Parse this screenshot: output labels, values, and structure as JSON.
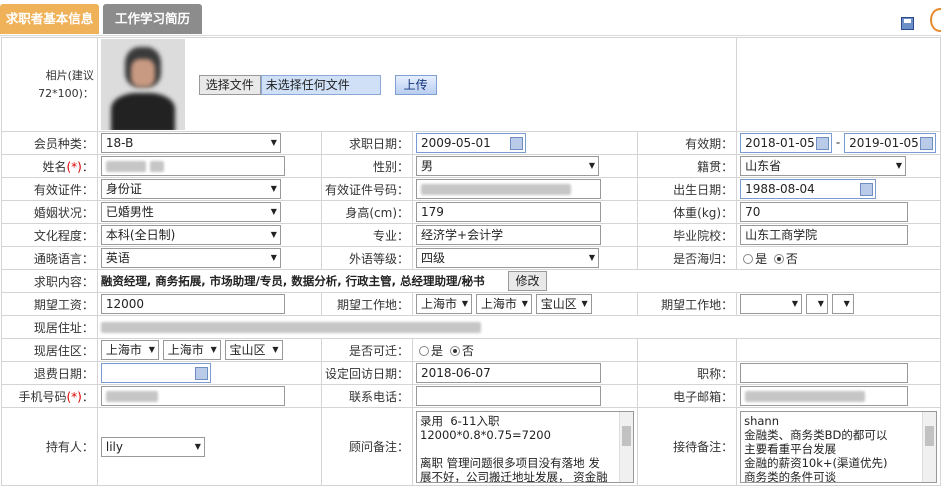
{
  "tabs": {
    "basic": "求职者基本信息",
    "resume": "工作学习简历"
  },
  "photo": {
    "label": "相片(建议72*100)：",
    "choose_file": "选择文件",
    "no_file": "未选择任何文件",
    "upload": "上传"
  },
  "member_type": {
    "label": "会员种类：",
    "value": "18-B"
  },
  "apply_date": {
    "label": "求职日期：",
    "value": "2009-05-01"
  },
  "valid_period": {
    "label": "有效期：",
    "from": "2018-01-05",
    "sep": "-",
    "to": "2019-01-05"
  },
  "name": {
    "label": "姓名",
    "star": "(*)",
    "colon": "："
  },
  "gender": {
    "label": "性别：",
    "value": "男"
  },
  "native": {
    "label": "籍贯：",
    "value": "山东省"
  },
  "id_type": {
    "label": "有效证件：",
    "value": "身份证"
  },
  "id_no": {
    "label": "有效证件号码："
  },
  "birth": {
    "label": "出生日期：",
    "value": "1988-08-04"
  },
  "marriage": {
    "label": "婚姻状况：",
    "value": "已婚男性"
  },
  "height": {
    "label": "身高(cm)：",
    "value": "179"
  },
  "weight": {
    "label": "体重(kg)：",
    "value": "70"
  },
  "education": {
    "label": "文化程度：",
    "value": "本科(全日制)"
  },
  "major": {
    "label": "专业：",
    "value": "经济学+会计学"
  },
  "school": {
    "label": "毕业院校：",
    "value": "山东工商学院"
  },
  "language": {
    "label": "通晓语言：",
    "value": "英语"
  },
  "foreign_level": {
    "label": "外语等级：",
    "value": "四级"
  },
  "overseas": {
    "label": "是否海归：",
    "yes": "是",
    "no": "否"
  },
  "job_content": {
    "label": "求职内容：",
    "value": "融资经理, 商务拓展, 市场助理/专员, 数据分析, 行政主管, 总经理助理/秘书",
    "edit": "修改"
  },
  "salary": {
    "label": "期望工资：",
    "value": "12000"
  },
  "work_place1": {
    "label": "期望工作地：",
    "province": "上海市",
    "city": "上海市",
    "district": "宝山区"
  },
  "work_place2": {
    "label": "期望工作地："
  },
  "address": {
    "label": "现居住址："
  },
  "area": {
    "label": "现居住区：",
    "province": "上海市",
    "city": "上海市",
    "district": "宝山区"
  },
  "relocate": {
    "label": "是否可迁：",
    "yes": "是",
    "no": "否"
  },
  "refund_date": {
    "label": "退费日期："
  },
  "visit_date": {
    "label": "设定回访日期：",
    "value": "2018-06-07"
  },
  "title_field": {
    "label": "职称："
  },
  "phone": {
    "label": "手机号码",
    "star": "(*)",
    "colon": "："
  },
  "tel": {
    "label": "联系电话："
  },
  "email": {
    "label": "电子邮箱："
  },
  "holder": {
    "label": "持有人：",
    "value": "lily"
  },
  "consultant_note": {
    "label": "顾问备注：",
    "text": "录用  6-11入职\n12000*0.8*0.75=7200\n\n离职 管理问题很多项目没有落地 发\n展不好，公司搬迁地址发展， 资金融"
  },
  "reception_note": {
    "label": "接待备注：",
    "text": "shann\n金融类、商务类BD的都可以\n主要看重平台发展\n金融的薪资10k+(渠道优先)\n商务类的条件可谈"
  },
  "colors": {
    "tab_active": "#f0b259",
    "tab_inactive": "#8c8c8c",
    "required": "#dd0000"
  }
}
